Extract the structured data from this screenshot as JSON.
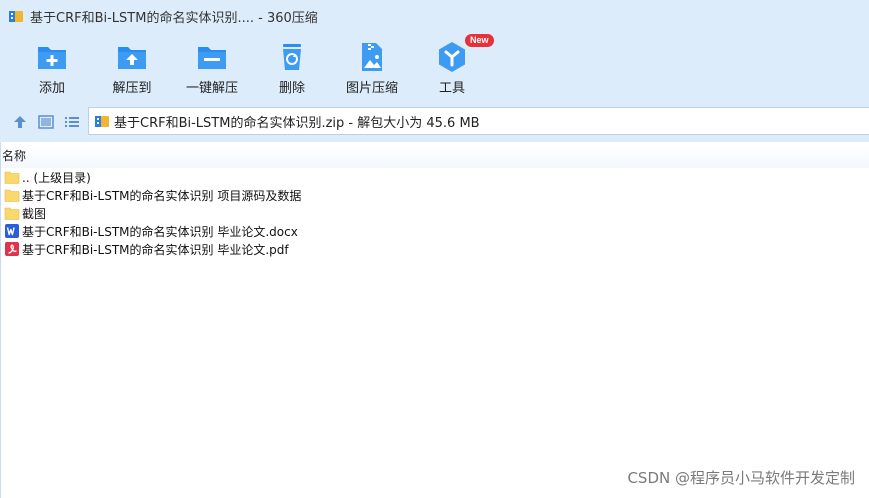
{
  "window": {
    "title": "基于CRF和Bi-LSTM的命名实体识别.... - 360压缩"
  },
  "toolbar": {
    "buttons": [
      {
        "label": "添加",
        "icon": "folder-add-icon"
      },
      {
        "label": "解压到",
        "icon": "folder-extract-icon"
      },
      {
        "label": "一键解压",
        "icon": "folder-oneclick-extract-icon"
      },
      {
        "label": "删除",
        "icon": "recycle-bin-icon"
      },
      {
        "label": "图片压缩",
        "icon": "image-compress-icon"
      },
      {
        "label": "工具",
        "icon": "tools-icon",
        "badge": "New"
      }
    ]
  },
  "address": {
    "path": "基于CRF和Bi-LSTM的命名实体识别.zip - 解包大小为 45.6 MB"
  },
  "list": {
    "column_header": "名称",
    "items": [
      {
        "name": ".. (上级目录)",
        "type": "folder"
      },
      {
        "name": "基于CRF和Bi-LSTM的命名实体识别 项目源码及数据",
        "type": "folder"
      },
      {
        "name": "截图",
        "type": "folder"
      },
      {
        "name": "基于CRF和Bi-LSTM的命名实体识别 毕业论文.docx",
        "type": "word"
      },
      {
        "name": "基于CRF和Bi-LSTM的命名实体识别 毕业论文.pdf",
        "type": "pdf"
      }
    ]
  },
  "watermark": "CSDN @程序员小马软件开发定制",
  "colors": {
    "chrome": "#dcecfb",
    "icon_blue": "#2a8ef0",
    "folder_yellow": "#fbd86b",
    "word_blue": "#2b5fd9",
    "pdf_red": "#e0324a",
    "badge_red": "#e6313a"
  }
}
